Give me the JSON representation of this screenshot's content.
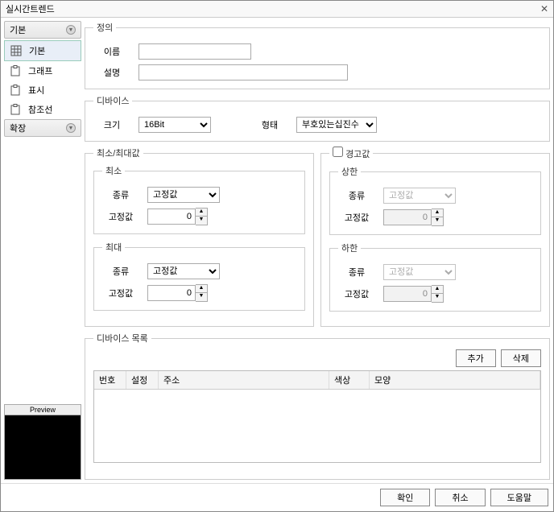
{
  "title": "실시간트렌드",
  "sidebar": {
    "basic_hdr": "기본",
    "items": [
      "기본",
      "그래프",
      "표시",
      "참조선"
    ],
    "ext_hdr": "확장"
  },
  "preview": {
    "label": "Preview"
  },
  "def": {
    "legend": "정의",
    "name_lbl": "이름",
    "name_val": "",
    "desc_lbl": "설명",
    "desc_val": ""
  },
  "dev": {
    "legend": "디바이스",
    "size_lbl": "크기",
    "size_val": "16Bit",
    "type_lbl": "형태",
    "type_val": "부호있는십진수"
  },
  "minmax": {
    "legend": "최소/최대값",
    "min": {
      "legend": "최소",
      "kind_lbl": "종류",
      "kind_val": "고정값",
      "fixed_lbl": "고정값",
      "fixed_val": "0"
    },
    "max": {
      "legend": "최대",
      "kind_lbl": "종류",
      "kind_val": "고정값",
      "fixed_lbl": "고정값",
      "fixed_val": "0"
    }
  },
  "warn": {
    "legend": "경고값",
    "upper": {
      "legend": "상한",
      "kind_lbl": "종류",
      "kind_val": "고정값",
      "fixed_lbl": "고정값",
      "fixed_val": "0"
    },
    "lower": {
      "legend": "하한",
      "kind_lbl": "종류",
      "kind_val": "고정값",
      "fixed_lbl": "고정값",
      "fixed_val": "0"
    }
  },
  "devlist": {
    "legend": "디바이스 목록",
    "add_btn": "추가",
    "del_btn": "삭제",
    "cols": {
      "no": "번호",
      "set": "설정",
      "addr": "주소",
      "color": "색상",
      "shape": "모양"
    }
  },
  "footer": {
    "ok": "확인",
    "cancel": "취소",
    "help": "도움말"
  }
}
